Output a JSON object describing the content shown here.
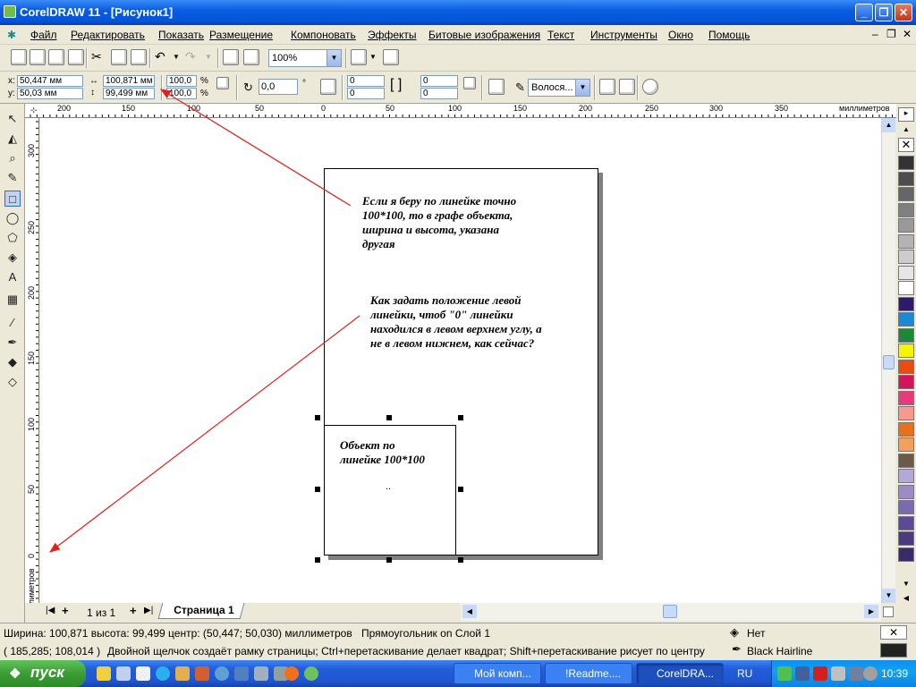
{
  "window": {
    "title": "CorelDRAW 11 - [Рисунок1]"
  },
  "menu": [
    "Файл",
    "Редактировать",
    "Показать",
    "Размещение",
    "Компоновать",
    "Эффекты",
    "Битовые изображения",
    "Текст",
    "Инструменты",
    "Окно",
    "Помощь"
  ],
  "toolbar": {
    "zoom": "100%"
  },
  "propbar": {
    "x_label": "x:",
    "x": "50,447 мм",
    "y_label": "y:",
    "y": "50,03 мм",
    "width": "100,871 мм",
    "height": "99,499 мм",
    "scale_x": "100,0",
    "scale_y": "100,0",
    "pct": "%",
    "rotation": "0,0",
    "deg": "°",
    "corner1": "0",
    "corner2": "0",
    "corner3": "0",
    "corner4": "0",
    "outline": "Волося..."
  },
  "ruler": {
    "unit": "миллиметров",
    "h_labels": [
      "200",
      "150",
      "100",
      "50",
      "0",
      "50",
      "100",
      "150",
      "200",
      "250",
      "300",
      "350"
    ],
    "v_labels": [
      "300",
      "250",
      "200",
      "150",
      "100",
      "50",
      "0"
    ],
    "v_unit": "миллиметров"
  },
  "notes": {
    "note1": [
      "Если я беру по линейке точно",
      "100*100, то в графе объекта,",
      "ширина и высота, указана",
      "другая"
    ],
    "note2": [
      "Как задать положение левой",
      "линейки, чтоб \"0\" линейки",
      "находился в левом верхнем углу, а",
      "не в левом нижнем, как сейчас?"
    ],
    "object_label": [
      "Объект по",
      "линейке 100*100"
    ],
    "center_mark": ".."
  },
  "tabs": {
    "pages": "1 из 1",
    "current": "Страница 1"
  },
  "status": {
    "dims": "Ширина: 100,871  высота: 99,499  центр: (50,447; 50,030)  миллиметров",
    "object": "Прямоугольник on Слой 1",
    "fill": "Нет",
    "coords": "( 185,285; 108,014 )",
    "hint": "Двойной щелчок создаёт рамку страницы; Ctrl+перетаскивание делает квадрат; Shift+перетаскивание рисует по центру",
    "outline": "Black  Hairline"
  },
  "taskbar": {
    "start": "пуск",
    "tasks": [
      "Мой комп...",
      "!Readme....",
      "CorelDRA..."
    ],
    "lang": "RU",
    "time": "10:39"
  },
  "palette": [
    "#333333",
    "#4d4d4d",
    "#666666",
    "#808080",
    "#999999",
    "#b3b3b3",
    "#cccccc",
    "#e6e6e6",
    "#ffffff",
    "#2e1a6e",
    "#1a8ad4",
    "#1a8a3a",
    "#f5f500",
    "#e84d0f",
    "#d4145a",
    "#e83a7a",
    "#f59a8c",
    "#e8701a",
    "#f5a05a",
    "#6b5a4a",
    "#b3a8d8",
    "#9c8ac8",
    "#7a6ab0",
    "#5a4a98",
    "#4a3a80",
    "#3a2a6a"
  ],
  "colors": {
    "accent": "#0a5de0",
    "arrow": "#e02020",
    "task_active": "#1d4fbf"
  }
}
